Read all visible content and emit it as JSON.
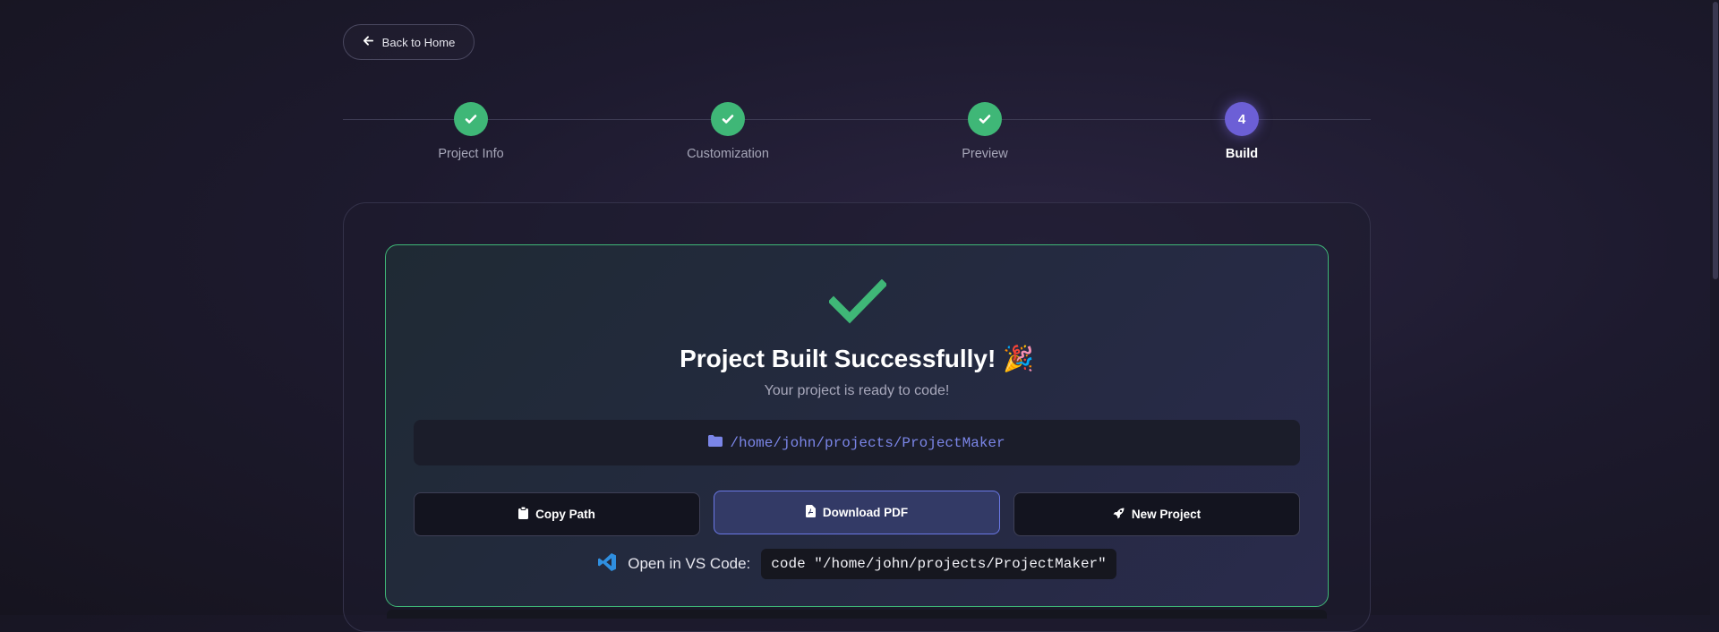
{
  "nav": {
    "back_label": "Back to Home"
  },
  "steps": [
    {
      "label": "Project Info",
      "status": "done"
    },
    {
      "label": "Customization",
      "status": "done"
    },
    {
      "label": "Preview",
      "status": "done"
    },
    {
      "label": "Build",
      "status": "active",
      "number": "4"
    }
  ],
  "result": {
    "title": "Project Built Successfully! 🎉",
    "subtitle": "Your project is ready to code!",
    "path": "/home/john/projects/ProjectMaker",
    "buttons": {
      "copy_path": "Copy Path",
      "download_pdf": "Download PDF",
      "new_project": "New Project"
    },
    "vscode_label": "Open in VS Code:",
    "vscode_command": "code \"/home/john/projects/ProjectMaker\""
  },
  "colors": {
    "success": "#3fb777",
    "accent": "#6c5fd6",
    "path": "#7b86e8",
    "vscode": "#2f8fe0"
  },
  "icons": {
    "back": "arrow-left-icon",
    "step_done": "check-icon",
    "success": "check-icon",
    "folder": "folder-icon",
    "clipboard": "clipboard-icon",
    "pdf": "file-pdf-icon",
    "rocket": "rocket-icon",
    "vscode": "vscode-icon"
  }
}
